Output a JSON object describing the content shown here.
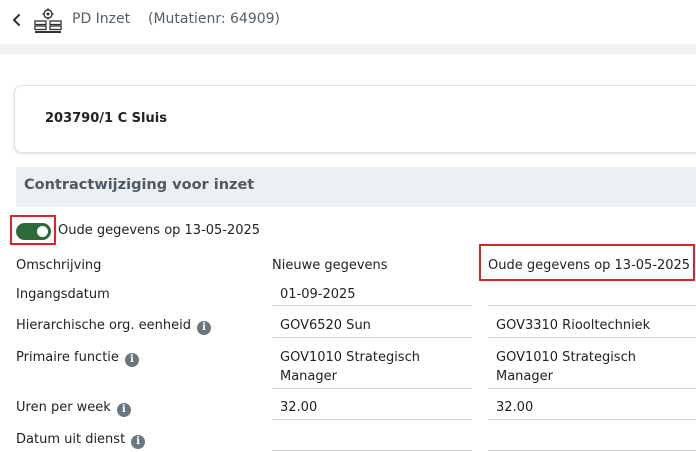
{
  "header": {
    "title": "PD Inzet",
    "mutatie": "(Mutatienr: 64909)"
  },
  "person": {
    "name": "203790/1  C Sluis"
  },
  "section": {
    "title": "Contractwijziging voor inzet"
  },
  "toggle": {
    "label": "Oude gegevens op 13-05-2025",
    "on": true
  },
  "table": {
    "col_labels": {
      "description": "Omschrijving",
      "new": "Nieuwe gegevens",
      "old": "Oude gegevens op 13-05-2025"
    },
    "rows": [
      {
        "label": "Ingangsdatum",
        "info": false,
        "new": "01-09-2025",
        "old": ""
      },
      {
        "label": "Hierarchische org. eenheid",
        "info": true,
        "new": "GOV6520 Sun",
        "old": "GOV3310 Riooltechniek"
      },
      {
        "label": "Primaire functie",
        "info": true,
        "new": "GOV1010 Strategisch Manager",
        "old": "GOV1010 Strategisch Manager"
      },
      {
        "label": "Uren per week",
        "info": true,
        "new": "32.00",
        "old": "32.00"
      },
      {
        "label": "Datum uit dienst",
        "info": true,
        "new": "",
        "old": ""
      }
    ]
  },
  "icons": {
    "back": "chevron-left-icon",
    "app": "organization-gear-icon",
    "info": "info-icon"
  },
  "colors": {
    "toggle_on": "#2d6a3a",
    "highlight": "#d9262b",
    "section_bg": "#edf0f2"
  }
}
